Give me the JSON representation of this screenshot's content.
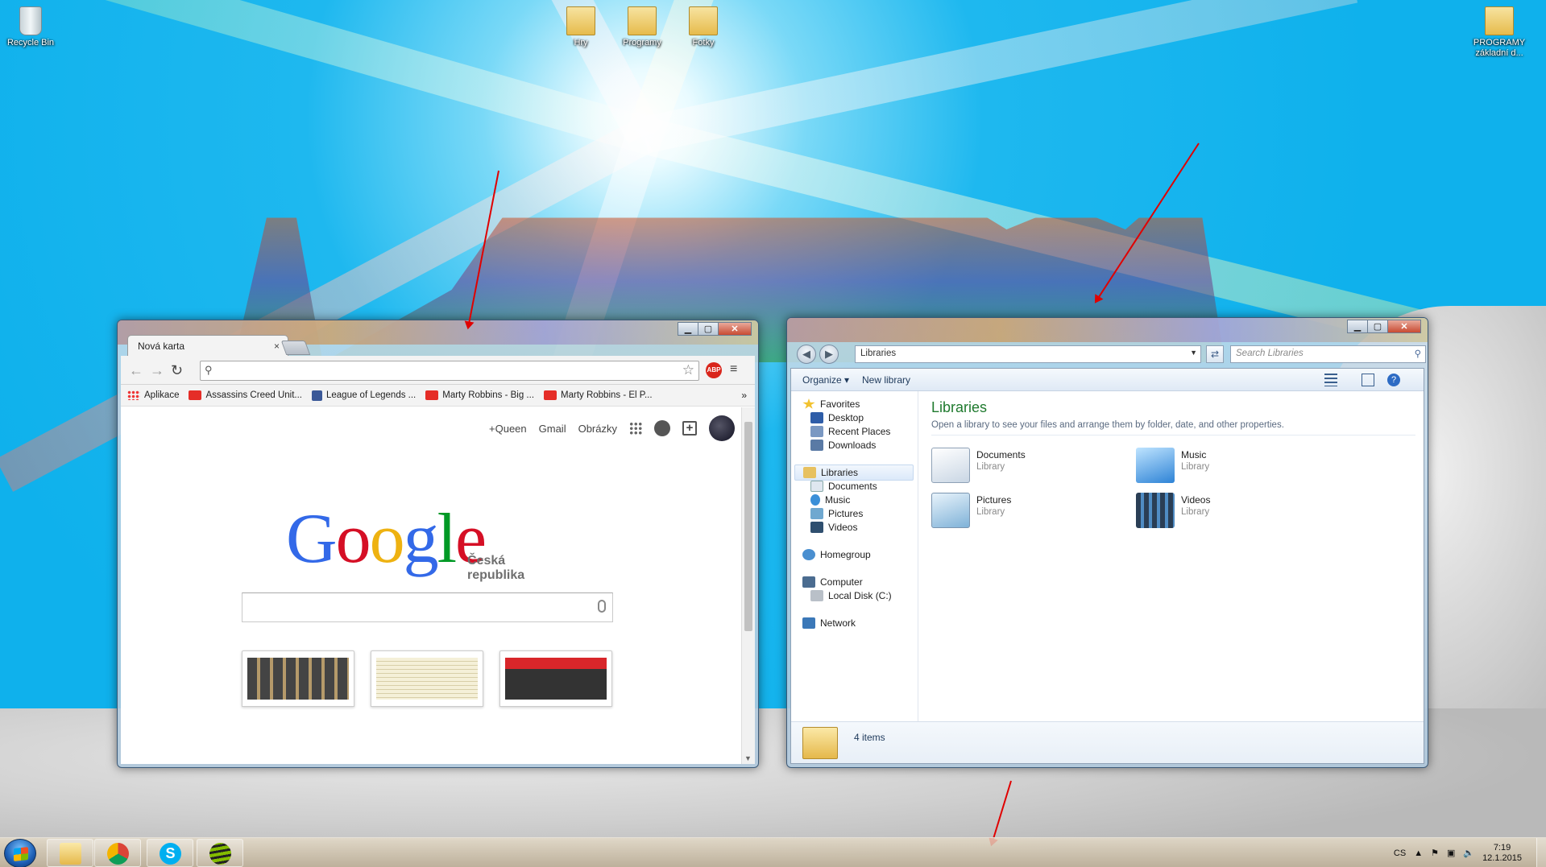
{
  "desktop": {
    "icons": [
      {
        "label": "Recycle Bin",
        "icon": "recycle-bin-icon"
      },
      {
        "label": "Hry",
        "icon": "folder-icon"
      },
      {
        "label": "Programy",
        "icon": "folder-icon"
      },
      {
        "label": "Fotky",
        "icon": "folder-icon"
      },
      {
        "label": "PROGRAMY",
        "label2": "základní d...",
        "icon": "folder-icon"
      }
    ]
  },
  "chrome": {
    "tab_title": "Nová karta",
    "tab_close": "×",
    "omnibox_value": "",
    "abp_label": "ABP",
    "bookmarks": [
      {
        "label": "Aplikace",
        "icon": "apps-icon"
      },
      {
        "label": "Assassins Creed Unit...",
        "icon": "youtube-icon"
      },
      {
        "label": "League of Legends ...",
        "icon": "facebook-icon"
      },
      {
        "label": "Marty Robbins - Big ...",
        "icon": "youtube-icon"
      },
      {
        "label": "Marty Robbins - El P...",
        "icon": "youtube-icon"
      }
    ],
    "bookmarks_more": "»",
    "top_links": {
      "queen": "+Queen",
      "gmail": "Gmail",
      "images": "Obrázky"
    },
    "logo_letters": [
      {
        "ch": "G",
        "color": "#3369e8"
      },
      {
        "ch": "o",
        "color": "#d50f25"
      },
      {
        "ch": "o",
        "color": "#eeb211"
      },
      {
        "ch": "g",
        "color": "#3369e8"
      },
      {
        "ch": "l",
        "color": "#009925"
      },
      {
        "ch": "e",
        "color": "#d50f25"
      }
    ],
    "logo_subtitle": "Česká republika",
    "search_value": ""
  },
  "explorer": {
    "breadcrumb": "Libraries",
    "search_placeholder": "Search Libraries",
    "commands": {
      "organize": "Organize",
      "new_library": "New library"
    },
    "nav": {
      "favorites": "Favorites",
      "favorites_items": [
        "Desktop",
        "Recent Places",
        "Downloads"
      ],
      "libraries": "Libraries",
      "libraries_items": [
        "Documents",
        "Music",
        "Pictures",
        "Videos"
      ],
      "homegroup": "Homegroup",
      "computer": "Computer",
      "computer_items": [
        "Local Disk (C:)"
      ],
      "network": "Network"
    },
    "title": "Libraries",
    "description": "Open a library to see your files and arrange them by folder, date, and other properties.",
    "items": [
      {
        "name": "Documents",
        "type": "Library"
      },
      {
        "name": "Music",
        "type": "Library"
      },
      {
        "name": "Pictures",
        "type": "Library"
      },
      {
        "name": "Videos",
        "type": "Library"
      }
    ],
    "status": "4 items"
  },
  "taskbar": {
    "pinned": [
      "explorer-icon",
      "chrome-icon",
      "skype-icon",
      "spotify-icon"
    ],
    "language": "CS",
    "time": "7:19",
    "date": "12.1.2015"
  }
}
